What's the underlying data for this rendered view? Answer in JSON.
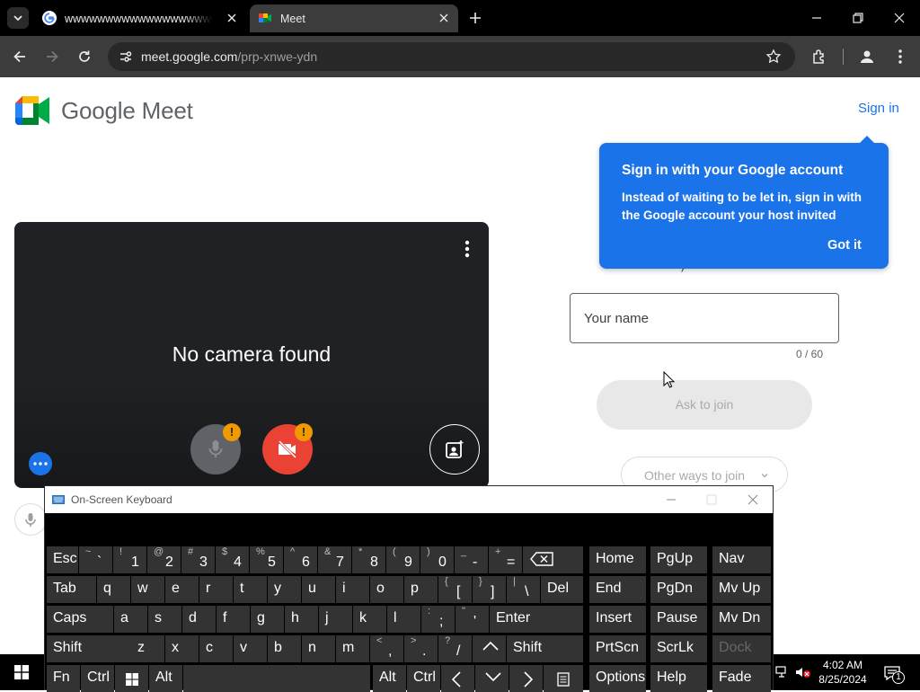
{
  "browser": {
    "tab1_title": "wwwwwwwwwwwwwwwwwwwwwwwwwwwwwwwwwwwwwww",
    "tab2_title": "Meet",
    "url_host": "meet.google.com",
    "url_path": "/prp-xnwe-ydn"
  },
  "header": {
    "logo_text": "Google Meet",
    "sign_in": "Sign in"
  },
  "preview": {
    "message": "No camera found",
    "mic_warning": "!",
    "cam_warning": "!"
  },
  "popup": {
    "title": "Sign in with your Google account",
    "body": "Instead of waiting to be let in, sign in with the Google account your host invited",
    "dismiss": "Got it"
  },
  "join": {
    "partial_heading_char": ")",
    "name_placeholder": "Your name",
    "name_value": "",
    "counter": "0 / 60",
    "ask_button": "Ask to join",
    "other_ways": "Other ways to join"
  },
  "osk": {
    "title": "On-Screen Keyboard",
    "rows": [
      [
        {
          "t": "Esc"
        },
        {
          "s": "~",
          "m": "`"
        },
        {
          "s": "!",
          "m": "1"
        },
        {
          "s": "@",
          "m": "2"
        },
        {
          "s": "#",
          "m": "3"
        },
        {
          "s": "$",
          "m": "4"
        },
        {
          "s": "%",
          "m": "5"
        },
        {
          "s": "^",
          "m": "6"
        },
        {
          "s": "&",
          "m": "7"
        },
        {
          "s": "*",
          "m": "8"
        },
        {
          "s": "(",
          "m": "9"
        },
        {
          "s": ")",
          "m": "0"
        },
        {
          "s": "_",
          "m": "-"
        },
        {
          "s": "+",
          "m": "="
        },
        {
          "icon": "backspace"
        },
        {
          "t": "Home"
        },
        {
          "t": "PgUp"
        },
        {
          "t": "Nav"
        }
      ],
      [
        {
          "t": "Tab"
        },
        {
          "t": "q"
        },
        {
          "t": "w"
        },
        {
          "t": "e"
        },
        {
          "t": "r"
        },
        {
          "t": "t"
        },
        {
          "t": "y"
        },
        {
          "t": "u"
        },
        {
          "t": "i"
        },
        {
          "t": "o"
        },
        {
          "t": "p"
        },
        {
          "s": "{",
          "m": "["
        },
        {
          "s": "}",
          "m": "]"
        },
        {
          "s": "|",
          "m": "\\"
        },
        {
          "t": "Del"
        },
        {
          "t": "End"
        },
        {
          "t": "PgDn"
        },
        {
          "t": "Mv Up"
        }
      ],
      [
        {
          "t": "Caps"
        },
        {
          "t": "a"
        },
        {
          "t": "s"
        },
        {
          "t": "d"
        },
        {
          "t": "f"
        },
        {
          "t": "g"
        },
        {
          "t": "h"
        },
        {
          "t": "j"
        },
        {
          "t": "k"
        },
        {
          "t": "l"
        },
        {
          "s": ":",
          "m": ";"
        },
        {
          "s": "\"",
          "m": "'"
        },
        {
          "t": "Enter"
        },
        {
          "t": "Insert"
        },
        {
          "t": "Pause"
        },
        {
          "t": "Mv Dn"
        }
      ],
      [
        {
          "t": "Shift"
        },
        {
          "t": "z"
        },
        {
          "t": "x"
        },
        {
          "t": "c"
        },
        {
          "t": "v"
        },
        {
          "t": "b"
        },
        {
          "t": "n"
        },
        {
          "t": "m"
        },
        {
          "s": "<",
          "m": ","
        },
        {
          "s": ">",
          "m": "."
        },
        {
          "s": "?",
          "m": "/"
        },
        {
          "icon": "up"
        },
        {
          "t": "Shift"
        },
        {
          "t": "PrtScn"
        },
        {
          "t": "ScrLk"
        },
        {
          "t": "Dock",
          "dim": true
        }
      ],
      [
        {
          "t": "Fn"
        },
        {
          "t": "Ctrl"
        },
        {
          "icon": "win"
        },
        {
          "t": "Alt"
        },
        {
          "t": ""
        },
        {
          "t": "Alt"
        },
        {
          "t": "Ctrl"
        },
        {
          "icon": "left"
        },
        {
          "icon": "down"
        },
        {
          "icon": "right"
        },
        {
          "icon": "menu"
        },
        {
          "t": "Options"
        },
        {
          "t": "Help"
        },
        {
          "t": "Fade"
        }
      ]
    ]
  },
  "taskbar": {
    "time": "4:02 AM",
    "date": "8/25/2024",
    "notification_count": "1"
  }
}
